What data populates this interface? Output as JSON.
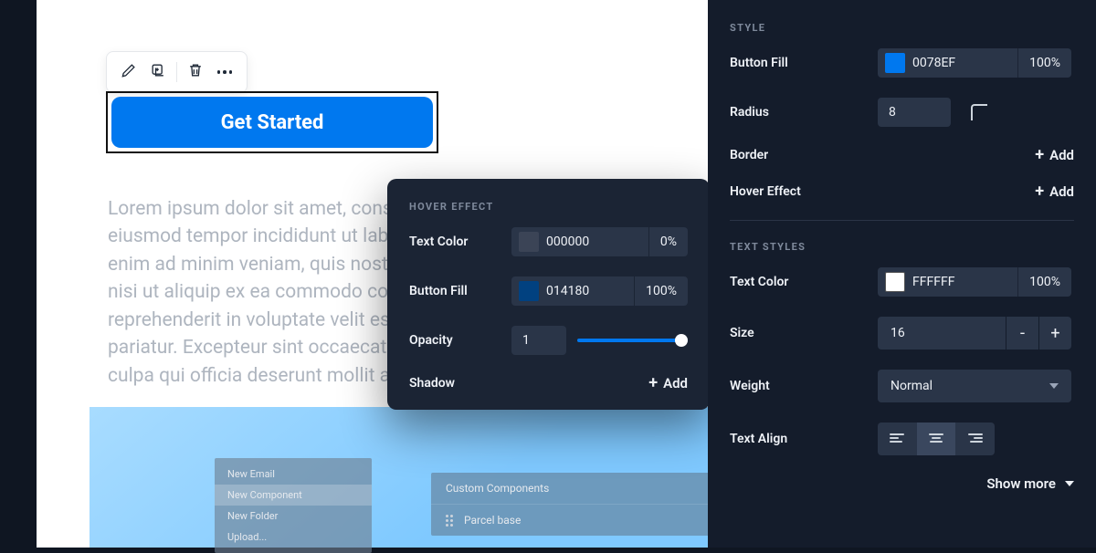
{
  "canvas": {
    "cta_label": "Get Started",
    "lorem": "Lorem ipsum dolor sit amet, consectetur adipiscing elit, sed do eiusmod tempor incididunt ut labore et dolore magna aliqua. Ut enim ad minim veniam, quis nostrud exercitation ullamco laboris nisi ut aliquip ex ea commodo consequat. Duis aute irure dolor in reprehenderit in voluptate velit esse cillum dolore eu fugiat nulla pariatur. Excepteur sint occaecat cupidatat non proident, sunt in culpa qui officia deserunt mollit anim id est laborum.",
    "mini_menu": [
      "New Email",
      "New Component",
      "New Folder",
      "Upload..."
    ],
    "components_header": "Custom Components",
    "components_item": "Parcel base"
  },
  "hover_popup": {
    "title": "HOVER EFFECT",
    "text_color": {
      "label": "Text Color",
      "hex": "000000",
      "pct": "0%",
      "swatch": "#3b4456"
    },
    "button_fill": {
      "label": "Button Fill",
      "hex": "014180",
      "pct": "100%",
      "swatch": "#014180"
    },
    "opacity": {
      "label": "Opacity",
      "value": "1"
    },
    "shadow": {
      "label": "Shadow",
      "add": "Add"
    }
  },
  "sidebar": {
    "style_section": "STYLE",
    "button_fill": {
      "label": "Button Fill",
      "hex": "0078EF",
      "pct": "100%",
      "swatch": "#0078EF"
    },
    "radius": {
      "label": "Radius",
      "value": "8"
    },
    "border": {
      "label": "Border",
      "add": "Add"
    },
    "hover_effect": {
      "label": "Hover Effect",
      "add": "Add"
    },
    "text_section": "TEXT STYLES",
    "text_color": {
      "label": "Text Color",
      "hex": "FFFFFF",
      "pct": "100%",
      "swatch": "#FFFFFF"
    },
    "size": {
      "label": "Size",
      "value": "16"
    },
    "weight": {
      "label": "Weight",
      "value": "Normal"
    },
    "text_align": {
      "label": "Text Align"
    },
    "show_more": "Show more"
  }
}
